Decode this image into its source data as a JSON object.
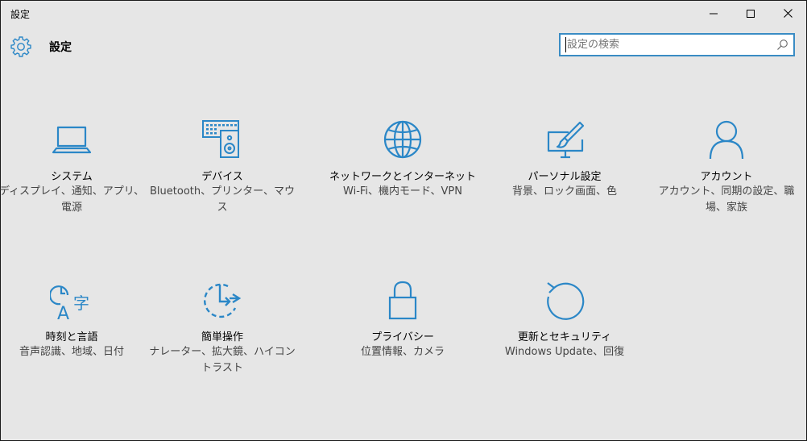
{
  "window": {
    "title": "設定"
  },
  "header": {
    "title": "設定",
    "icon": "gear-icon"
  },
  "search": {
    "placeholder": "設定の検索",
    "value": ""
  },
  "colors": {
    "accent": "#3a8cc4",
    "background": "#e6e6e6",
    "icon": "#2b87c7"
  },
  "tiles": [
    {
      "title": "システム",
      "desc": "ディスプレイ、通知、アプリ、電源",
      "icon": "laptop-icon"
    },
    {
      "title": "デバイス",
      "desc": "Bluetooth、プリンター、マウス",
      "icon": "devices-icon"
    },
    {
      "title": "ネットワークとインターネット",
      "desc": "Wi-Fi、機内モード、VPN",
      "icon": "globe-icon"
    },
    {
      "title": "パーソナル設定",
      "desc": "背景、ロック画面、色",
      "icon": "personalization-icon"
    },
    {
      "title": "アカウント",
      "desc": "アカウント、同期の設定、職場、家族",
      "icon": "person-icon"
    },
    {
      "title": "時刻と言語",
      "desc": "音声認識、地域、日付",
      "icon": "time-language-icon"
    },
    {
      "title": "簡単操作",
      "desc": "ナレーター、拡大鏡、ハイコントラスト",
      "icon": "ease-of-access-icon"
    },
    {
      "title": "プライバシー",
      "desc": "位置情報、カメラ",
      "icon": "lock-icon"
    },
    {
      "title": "更新とセキュリティ",
      "desc": "Windows Update、回復",
      "icon": "update-icon"
    }
  ]
}
